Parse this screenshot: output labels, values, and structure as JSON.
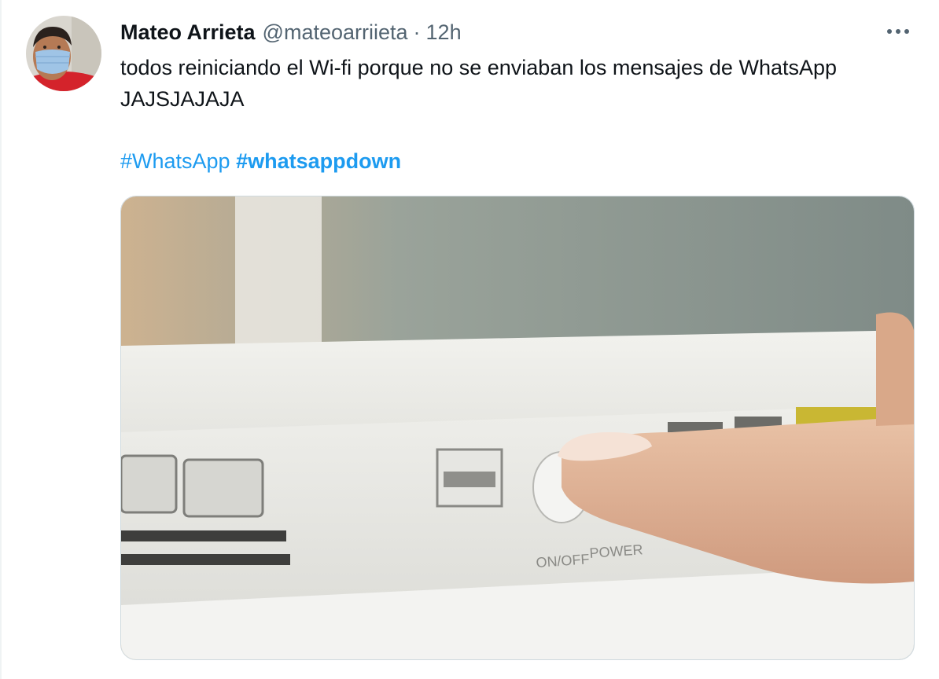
{
  "tweet": {
    "author": {
      "display_name": "Mateo Arrieta",
      "handle": "@mateoarriieta",
      "avatar_icon": "avatar-photo-masked-person"
    },
    "separator": "·",
    "timestamp": "12h",
    "more_icon": "more-horizontal-icon",
    "text_lines": [
      "todos reiniciando el Wi-fi porque no se enviaban los mensajes de WhatsApp",
      "JAJSJAJAJA"
    ],
    "hashtags": [
      {
        "text": "#WhatsApp",
        "bold": false
      },
      {
        "text": "#whatsappdown",
        "bold": true
      }
    ],
    "media": {
      "kind": "photo",
      "printed_labels": [
        "ON/OFF",
        "POWER"
      ]
    }
  },
  "colors": {
    "text": "#0f1419",
    "secondary": "#536471",
    "link": "#1d9bf0",
    "border": "#cfd9de"
  }
}
